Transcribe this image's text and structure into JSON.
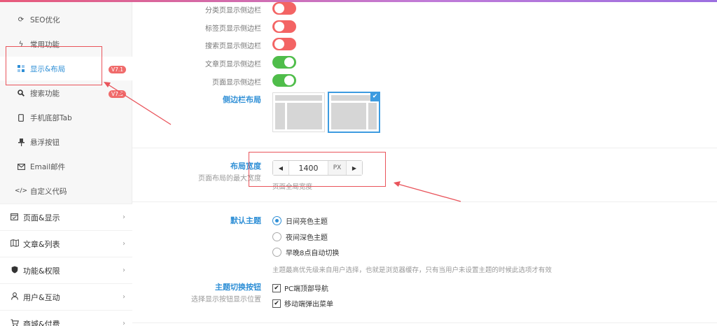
{
  "sidebar": {
    "sub_items": [
      {
        "label": "SEO优化",
        "icon": "refresh-icon"
      },
      {
        "label": "常用功能",
        "icon": "bolt-icon"
      },
      {
        "label": "显示&布局",
        "icon": "layout-icon",
        "active": true,
        "badge": "V7.1"
      },
      {
        "label": "搜索功能",
        "icon": "search-icon",
        "badge": "V7.5"
      },
      {
        "label": "手机底部Tab",
        "icon": "mobile-icon"
      },
      {
        "label": "悬浮按钮",
        "icon": "pin-icon"
      },
      {
        "label": "Email邮件",
        "icon": "mail-icon"
      },
      {
        "label": "自定义代码",
        "icon": "code-icon"
      }
    ],
    "main_items": [
      {
        "label": "页面&显示",
        "icon": "calendar-icon"
      },
      {
        "label": "文章&列表",
        "icon": "map-icon"
      },
      {
        "label": "功能&权限",
        "icon": "shield-icon"
      },
      {
        "label": "用户&互动",
        "icon": "user-icon"
      },
      {
        "label": "商城&付费",
        "icon": "cart-icon"
      }
    ]
  },
  "toggles": [
    {
      "label": "分类页显示侧边栏",
      "on": false
    },
    {
      "label": "标签页显示侧边栏",
      "on": false
    },
    {
      "label": "搜索页显示侧边栏",
      "on": false
    },
    {
      "label": "文章页显示侧边栏",
      "on": true
    },
    {
      "label": "页面显示侧边栏",
      "on": true
    }
  ],
  "sidebar_layout": {
    "title": "侧边栏布局",
    "selected": "top-full"
  },
  "layout_width": {
    "title": "布局宽度",
    "subtitle": "页面布局的最大宽度",
    "value": "1400",
    "unit": "PX",
    "hint": "页面全局宽度"
  },
  "default_theme": {
    "title": "默认主题",
    "options": [
      {
        "label": "日间亮色主题",
        "checked": true
      },
      {
        "label": "夜间深色主题",
        "checked": false
      },
      {
        "label": "早晚8点自动切换",
        "checked": false
      }
    ],
    "hint": "主题最高优先级来自用户选择，也就是浏览器缓存，只有当用户未设置主题的时候此选项才有效"
  },
  "theme_switch": {
    "title": "主题切换按钮",
    "subtitle": "选择显示按钮显示位置",
    "options": [
      {
        "label": "PC端顶部导航",
        "checked": true
      },
      {
        "label": "移动端弹出菜单",
        "checked": true
      }
    ]
  },
  "icons": {
    "check": "✔",
    "chevron": "›",
    "left": "◀",
    "right": "▶"
  },
  "colors": {
    "accent": "#2f8fd6",
    "toggle_off": "#f36464",
    "toggle_on": "#4fbd4a",
    "annotation": "#e9545b"
  }
}
